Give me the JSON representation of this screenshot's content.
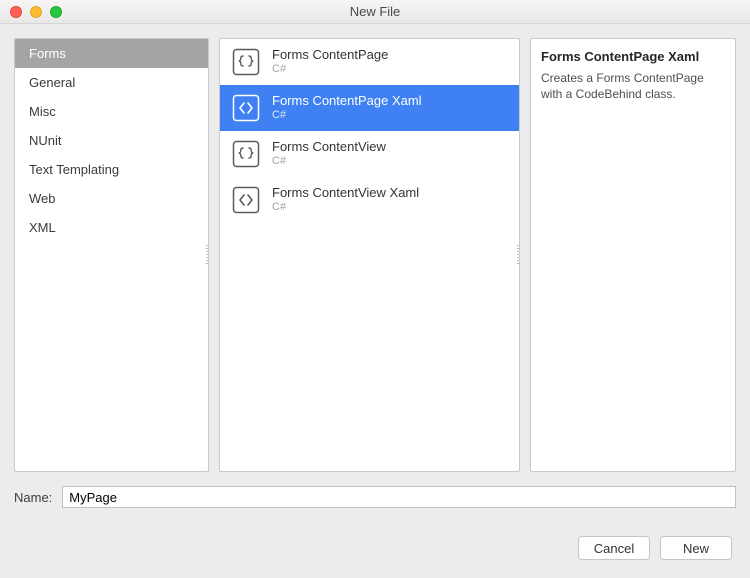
{
  "window": {
    "title": "New File"
  },
  "categories": [
    {
      "label": "Forms",
      "selected": true
    },
    {
      "label": "General",
      "selected": false
    },
    {
      "label": "Misc",
      "selected": false
    },
    {
      "label": "NUnit",
      "selected": false
    },
    {
      "label": "Text Templating",
      "selected": false
    },
    {
      "label": "Web",
      "selected": false
    },
    {
      "label": "XML",
      "selected": false
    }
  ],
  "templates": [
    {
      "title": "Forms ContentPage",
      "subtitle": "C#",
      "icon": "braces",
      "selected": false
    },
    {
      "title": "Forms ContentPage Xaml",
      "subtitle": "C#",
      "icon": "angles",
      "selected": true
    },
    {
      "title": "Forms ContentView",
      "subtitle": "C#",
      "icon": "braces",
      "selected": false
    },
    {
      "title": "Forms ContentView Xaml",
      "subtitle": "C#",
      "icon": "angles",
      "selected": false
    }
  ],
  "detail": {
    "title": "Forms ContentPage Xaml",
    "description": "Creates a Forms ContentPage with a CodeBehind class."
  },
  "name_field": {
    "label": "Name:",
    "value": "MyPage"
  },
  "buttons": {
    "cancel": "Cancel",
    "new": "New"
  }
}
